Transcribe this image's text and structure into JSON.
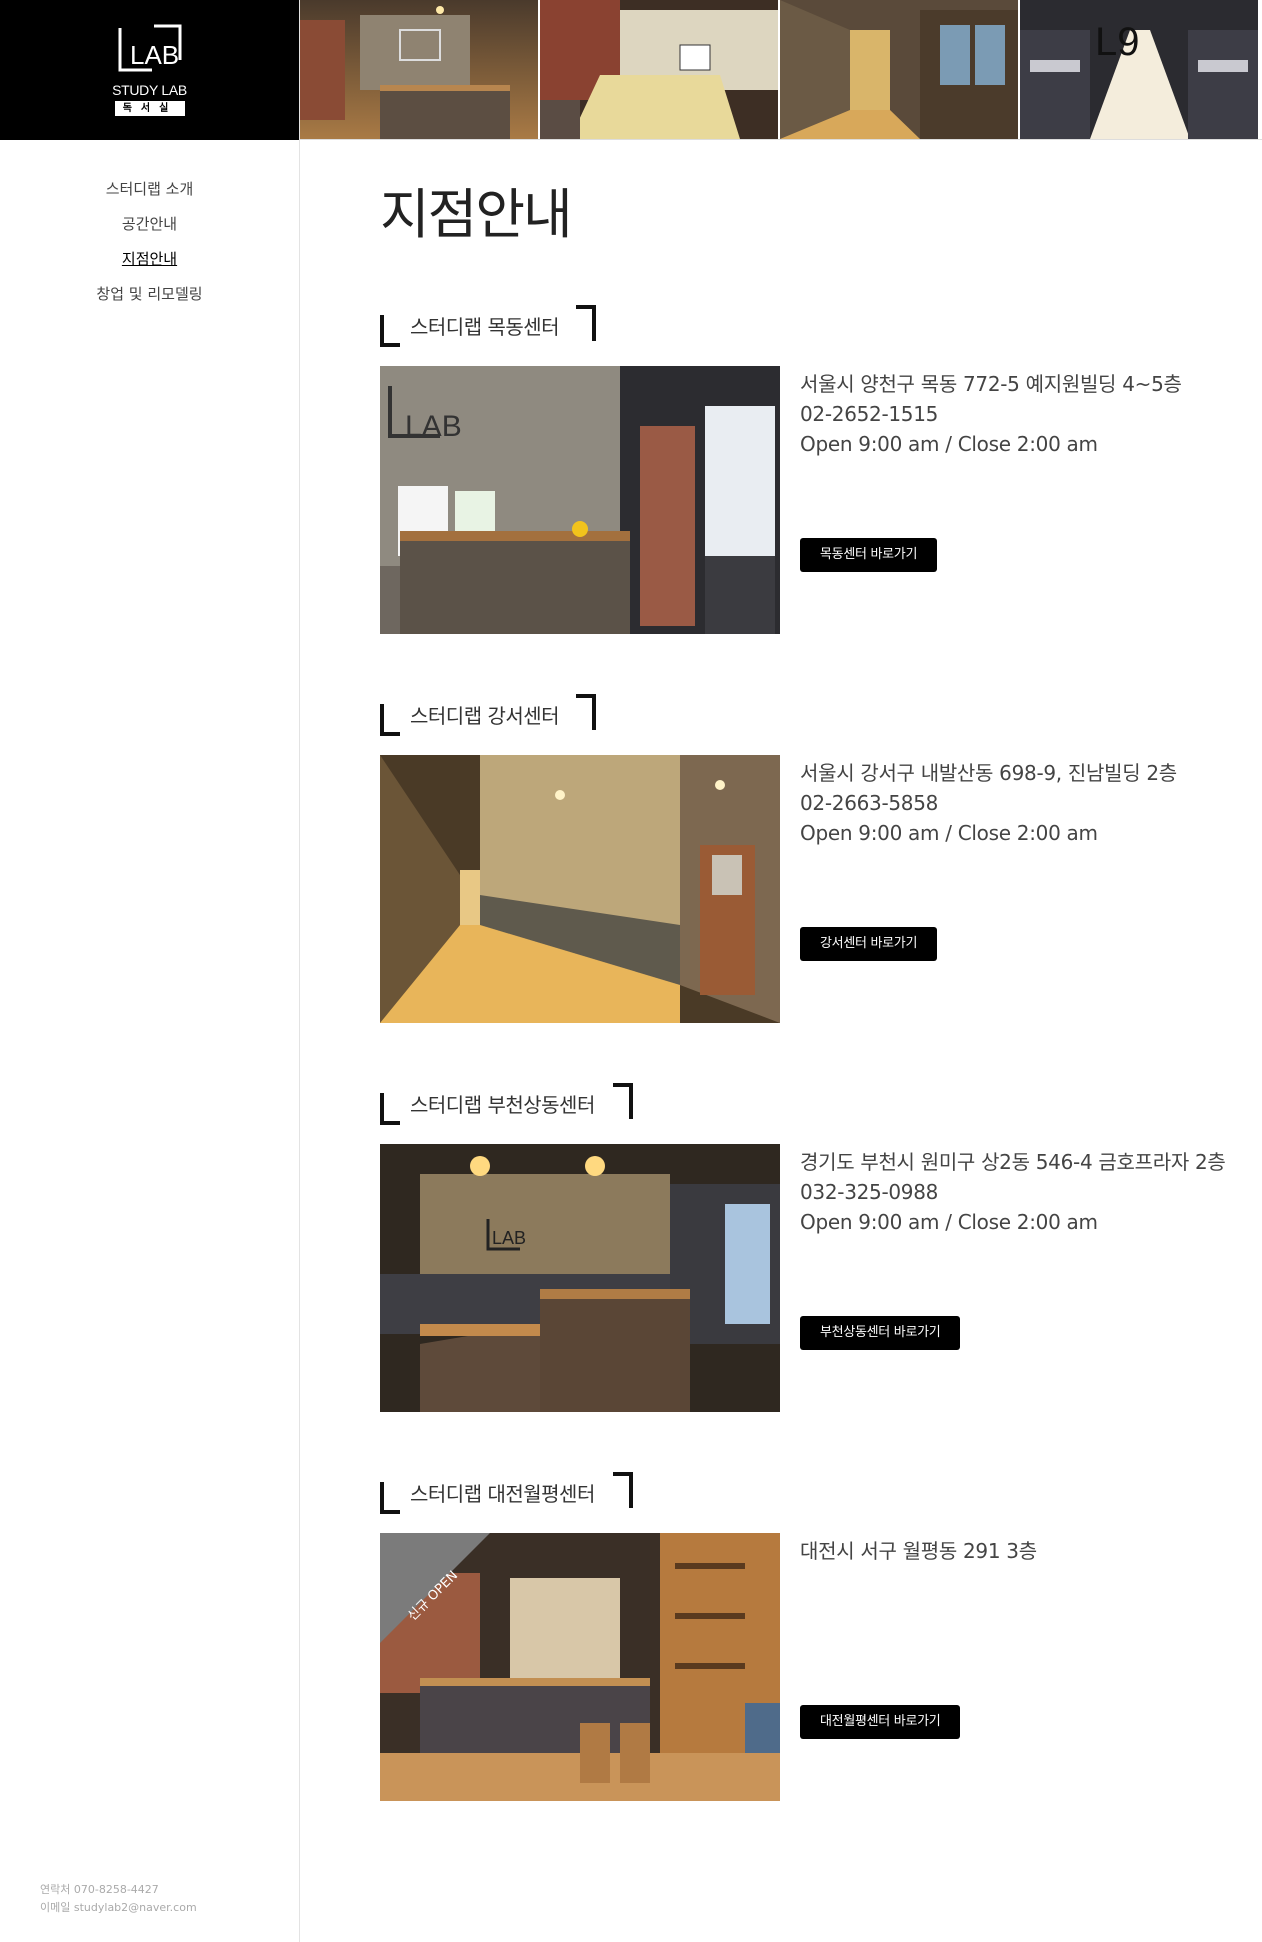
{
  "logo": {
    "mark_text": "LAB",
    "subtitle": "STUDY LAB",
    "korean": "독서실"
  },
  "nav": [
    {
      "label": "스터디랩 소개",
      "active": false
    },
    {
      "label": "공간안내",
      "active": false
    },
    {
      "label": "지점안내",
      "active": true
    },
    {
      "label": "창업 및 리모델링",
      "active": false
    }
  ],
  "contact": {
    "phone_label": "연락처",
    "phone": "070-8258-4427",
    "email_label": "이메일",
    "email": "studylab2@naver.com"
  },
  "banner_photos": [
    {
      "icon": "reception-photo"
    },
    {
      "icon": "meeting-room-photo"
    },
    {
      "icon": "hallway-photo"
    },
    {
      "icon": "study-room-photo",
      "overlay_text": "L9"
    }
  ],
  "page": {
    "title": "지점안내"
  },
  "branches": [
    {
      "name": "스터디랩 목동센터",
      "address": "서울시 양천구 목동 772-5 예지원빌딩 4~5층",
      "phone": "02-2652-1515",
      "hours": "Open 9:00 am / Close 2:00 am",
      "button": "목동센터 바로가기",
      "photo": "reception"
    },
    {
      "name": "스터디랩 강서센터",
      "address": "서울시 강서구 내발산동 698-9, 진남빌딩 2층",
      "phone": "02-2663-5858",
      "hours": "Open 9:00 am / Close 2:00 am",
      "button": "강서센터 바로가기",
      "photo": "hallway"
    },
    {
      "name": "스터디랩 부천상동센터",
      "address": "경기도 부천시 원미구 상2동 546-4 금호프라자 2층",
      "phone": "032-325-0988",
      "hours": "Open 9:00 am / Close 2:00 am",
      "button": "부천상동센터 바로가기",
      "photo": "reception-desk"
    },
    {
      "name": "스터디랩 대전월평센터",
      "address": "대전시 서구 월평동 291 3층",
      "phone": "",
      "hours": "",
      "button": "대전월평센터 바로가기",
      "photo": "lobby",
      "ribbon": "신규 OPEN"
    }
  ]
}
